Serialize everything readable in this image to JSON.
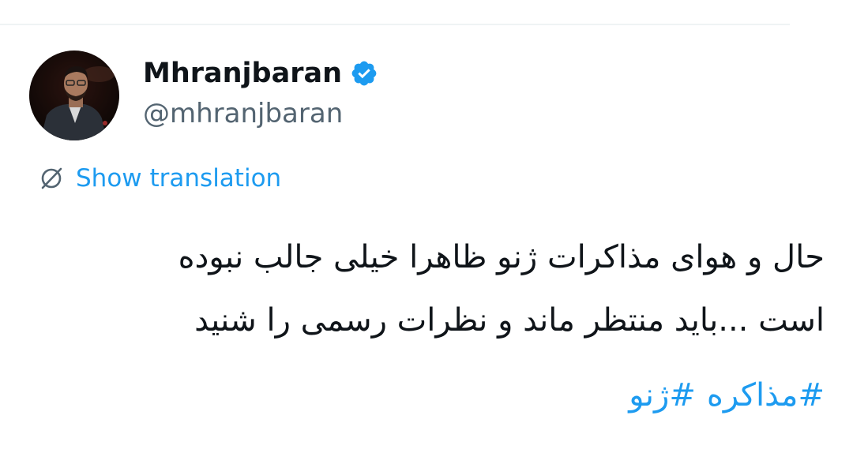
{
  "tweet": {
    "author": {
      "display_name": "Mhranjbaran",
      "handle": "@mhranjbaran",
      "verified": true,
      "verified_icon": "verified-badge-icon"
    },
    "translation": {
      "icon": "translate-icon",
      "label": "Show translation"
    },
    "text_lines": [
      "حال و هوای مذاکرات ژنو  ظاهرا خیلی جالب نبوده",
      "است ...باید منتظر ماند و نظرات رسمی را شنید"
    ],
    "hashtags": [
      "#مذاکره",
      "#ژنو"
    ]
  },
  "colors": {
    "accent": "#1d9bf0",
    "text_primary": "#0f1419",
    "text_secondary": "#536471",
    "divider": "#eff3f4",
    "background": "#ffffff"
  }
}
